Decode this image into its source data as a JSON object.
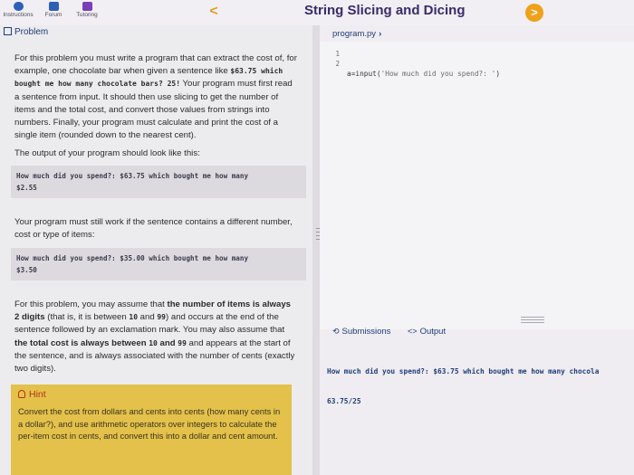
{
  "nav": {
    "tabs": [
      {
        "label": "Instructions",
        "icon": "info-icon",
        "color": "#2e5fb8"
      },
      {
        "label": "Forum",
        "icon": "chat-icon",
        "color": "#2e5fb8"
      },
      {
        "label": "Tutoring",
        "icon": "tutoring-icon",
        "color": "#7a3fb8"
      }
    ]
  },
  "header": {
    "title": "String Slicing and Dicing",
    "prev_glyph": "<",
    "next_glyph": ">",
    "accent": "#f0a11a"
  },
  "problem": {
    "tab_label": "Problem",
    "p1_a": "For this problem you must write a program that can extract the cost of, for example, one chocolate bar when given a sentence like ",
    "p1_code": "$63.75 which bought me how many chocolate bars? 25!",
    "p1_b": " Your program must first read a sentence from input. It should then use slicing to get the number of items and the total cost, and convert those values from strings into numbers. Finally, your program must calculate and print the cost of a single item (rounded down to the nearest cent).",
    "p2": "The output of your program should look like this:",
    "example1_line1": "How much did you spend?: $63.75 which bought me how many",
    "example1_line2": "$2.55",
    "p3": "Your program must still work if the sentence contains a different number, cost or type of items:",
    "example2_line1": "How much did you spend?: $35.00 which bought me how many",
    "example2_line2": "$3.50",
    "p4_a": "For this problem, you may assume that ",
    "p4_b1": "the number of items is always 2 digits",
    "p4_c": " (that is, it is between ",
    "p4_code1": "10",
    "p4_d": " and ",
    "p4_code2": "99",
    "p4_e": ") and occurs at the end of the sentence followed by an exclamation mark. You may also assume that ",
    "p4_b2": "the total cost is always between ",
    "p4_code3": "10",
    "p4_f": " and ",
    "p4_code4": "99",
    "p4_g": " and appears at the start of the sentence, and is always associated with the number of cents (exactly two digits).",
    "hint_title": "Hint",
    "hint_text": "Convert the cost from dollars and cents into cents (how many cents in a dollar?), and use arithmetic operators over integers to calculate the per-item cost in cents, and convert this into a dollar and cent amount."
  },
  "editor": {
    "file_tab": "program.py",
    "lines": [
      {
        "num": "1",
        "code_a": "a=input(",
        "code_str": "'How much did you spend?: '",
        "code_b": ")"
      },
      {
        "num": "2",
        "code_a": "",
        "code_str": "",
        "code_b": ""
      }
    ]
  },
  "output": {
    "tabs": [
      {
        "label": "Submissions",
        "icon": "history-icon"
      },
      {
        "label": "Output",
        "icon": "code-icon"
      }
    ],
    "line1": "How much did you spend?: $63.75 which bought me how many chocola",
    "line2": "63.75/25"
  }
}
